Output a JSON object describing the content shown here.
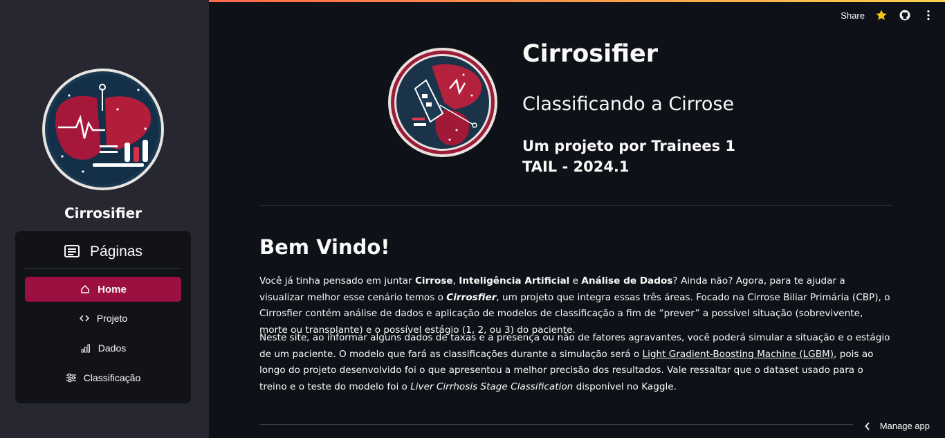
{
  "app": {
    "name": "Cirrosifier",
    "accent": "#9b1040",
    "background": "#0e1117",
    "sidebar_background": "#262730"
  },
  "header": {
    "share_label": "Share",
    "icons": [
      "star-icon",
      "github-icon",
      "more-vertical-icon"
    ]
  },
  "sidebar": {
    "title": "Cirrosifier",
    "menu_title": "Páginas",
    "items": [
      {
        "label": "Home",
        "icon": "home-icon",
        "active": true
      },
      {
        "label": "Projeto",
        "icon": "code-icon",
        "active": false
      },
      {
        "label": "Dados",
        "icon": "bar-chart-icon",
        "active": false
      },
      {
        "label": "Classificação",
        "icon": "sliders-icon",
        "active": false
      }
    ]
  },
  "hero": {
    "title": "Cirrosifier",
    "subtitle": "Classificando a Cirrose",
    "credit_line1": "Um projeto por Trainees 1",
    "credit_line2": "TAIL - 2024.1"
  },
  "main": {
    "welcome_title": "Bem Vindo!",
    "p1": {
      "t1": "Você já tinha pensado em juntar ",
      "b1": "Cirrose",
      "t2": ", ",
      "b2": "Inteligência Artificial",
      "t3": " e ",
      "b3": "Análise de Dados",
      "t4": "? Ainda não? Agora, para te ajudar a visualizar melhor esse cenário temos o ",
      "i1": "Cirrosfier",
      "t5": ", um projeto que integra essas três áreas. Focado na Cirrose Biliar Primária (CBP), o Cirrosfier contém análise de dados e aplicação de modelos de classificação a fim de “prever” a possível situação (sobrevivente, morte ou transplante) e o possível estágio (1, 2, ou 3) do paciente."
    },
    "p2": {
      "t1": "Neste site, ao informar alguns dados de taxas e a presença ou não de fatores agravantes, você poderá simular a situação e o estágio de um paciente. O modelo que fará as classificações durante a simulação será o ",
      "link": "Light Gradient-Boosting Machine (LGBM)",
      "t2": ", pois ao longo do projeto desenvolvido foi o que apresentou a melhor precisão dos resultados. Vale ressaltar que o dataset usado para o treino e o teste do modelo foi o ",
      "i1": "Liver Cirrhosis Stage Classification",
      "t3": " disponível no Kaggle."
    }
  },
  "footer": {
    "manage_app_label": "Manage app"
  }
}
